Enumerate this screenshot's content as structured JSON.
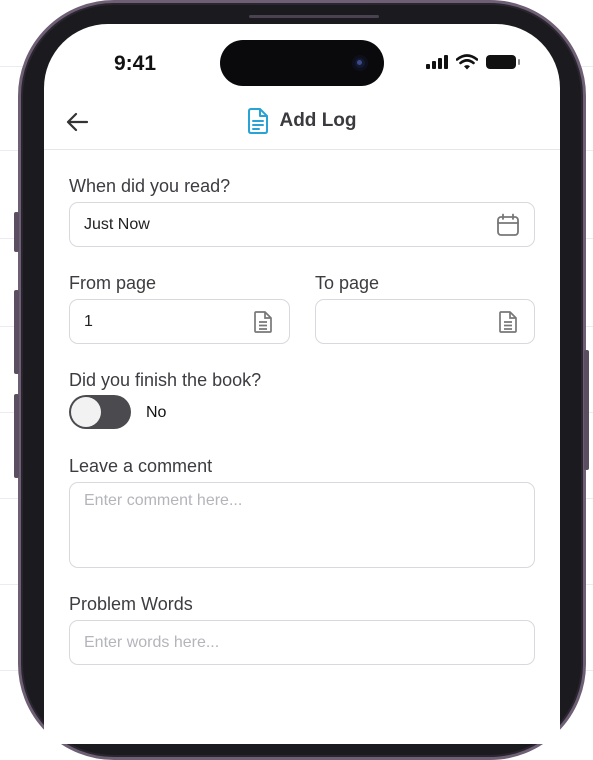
{
  "status_bar": {
    "time": "9:41"
  },
  "header": {
    "title": "Add Log",
    "title_icon": "document-icon",
    "back_icon": "arrow-left-icon",
    "accent": "#29a3d6"
  },
  "form": {
    "when": {
      "label": "When did you read?",
      "value": "Just Now",
      "icon": "calendar-icon"
    },
    "from_page": {
      "label": "From page",
      "value": "1",
      "icon": "document-icon"
    },
    "to_page": {
      "label": "To page",
      "value": "",
      "icon": "document-icon"
    },
    "finished": {
      "label": "Did you finish the book?",
      "value": "No",
      "on": false
    },
    "comment": {
      "label": "Leave a comment",
      "placeholder": "Enter comment here..."
    },
    "problem_words": {
      "label": "Problem Words",
      "placeholder": "Enter words here..."
    }
  }
}
